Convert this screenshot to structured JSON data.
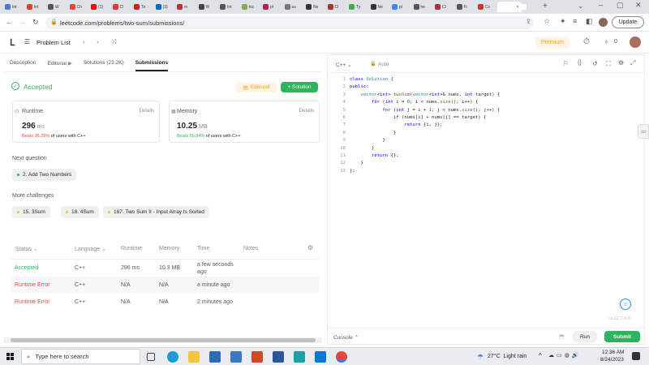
{
  "browser": {
    "tabs": [
      "Int",
      "Int",
      "W",
      "Ch",
      "(1)",
      "C!",
      "To",
      "(3)",
      "m",
      "W",
      "Int",
      "Inc",
      "pl",
      "su",
      "Ne",
      "Cl",
      "Ty",
      "Ne",
      "pl",
      "he",
      "Cl",
      "Fi",
      "Cc",
      "",
      ""
    ],
    "url": "leetcode.com/problems/two-sum/submissions/",
    "update_label": "Update"
  },
  "lcnav": {
    "problem_list": "Problem List",
    "premium": "Premium",
    "streak": "0"
  },
  "left": {
    "tabs": [
      "Description",
      "Editorial",
      "Solutions (23.2K)",
      "Submissions"
    ],
    "status": "Accepted",
    "editorial_btn": "Editorial",
    "solution_btn": "+ Solution",
    "runtime": {
      "label": "Runtime",
      "details": "Details",
      "value": "296",
      "unit": "ms",
      "beats_pct": "Beats 36.39%",
      "beats_rest": "of users with C++"
    },
    "memory": {
      "label": "Memory",
      "details": "Details",
      "value": "10.25",
      "unit": "MB",
      "beats_pct": "Beats 59.84%",
      "beats_rest": "of users with C++"
    },
    "next_question_title": "Next question",
    "next_question": "2. Add Two Numbers",
    "more_title": "More challenges",
    "challenges": [
      "15. 3Sum",
      "18. 4Sum",
      "167. Two Sum II - Input Array Is Sorted"
    ],
    "table_headers": [
      "Status",
      "Language",
      "Runtime",
      "Memory",
      "Time",
      "Notes"
    ],
    "rows": [
      {
        "status": "Accepted",
        "lang": "C++",
        "runtime": "296 ms",
        "memory": "10.3 MB",
        "time": "a few seconds ago"
      },
      {
        "status": "Runtime Error",
        "lang": "C++",
        "runtime": "N/A",
        "memory": "N/A",
        "time": "a minute ago"
      },
      {
        "status": "Runtime Error",
        "lang": "C++",
        "runtime": "N/A",
        "memory": "N/A",
        "time": "2 minutes ago"
      }
    ]
  },
  "editor": {
    "language": "C++",
    "mode": "Auto",
    "lines": [
      "1",
      "2",
      "3",
      "4",
      "5",
      "6",
      "7",
      "8",
      "9",
      "10",
      "11",
      "12",
      "13"
    ],
    "cursor": "Ln 12, Col 6",
    "console": "Console",
    "run": "Run",
    "submit": "Submit"
  },
  "taskbar": {
    "search_placeholder": "Type here to search",
    "weather": "27°C  Light rain",
    "time": "12:36 AM",
    "date": "8/24/2023"
  },
  "colors": {
    "accent_green": "#2db55d",
    "error_red": "#ef4743",
    "premium_orange": "#ffa116"
  }
}
